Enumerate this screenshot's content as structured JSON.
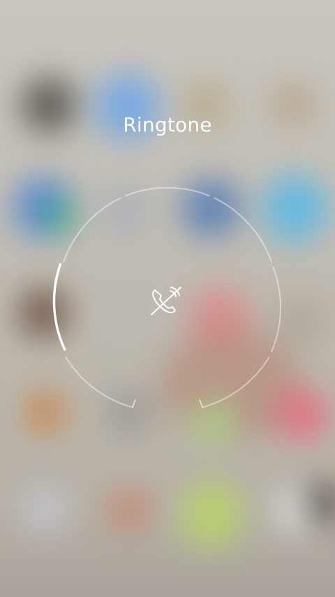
{
  "title": "Ringtone",
  "dial": {
    "active_segment": "left",
    "center_icon": "ringer-off-icon"
  },
  "colors": {
    "text": "#ffffff",
    "arc_dim": "rgba(255,255,255,0.45)",
    "arc_active": "#ffffff"
  }
}
